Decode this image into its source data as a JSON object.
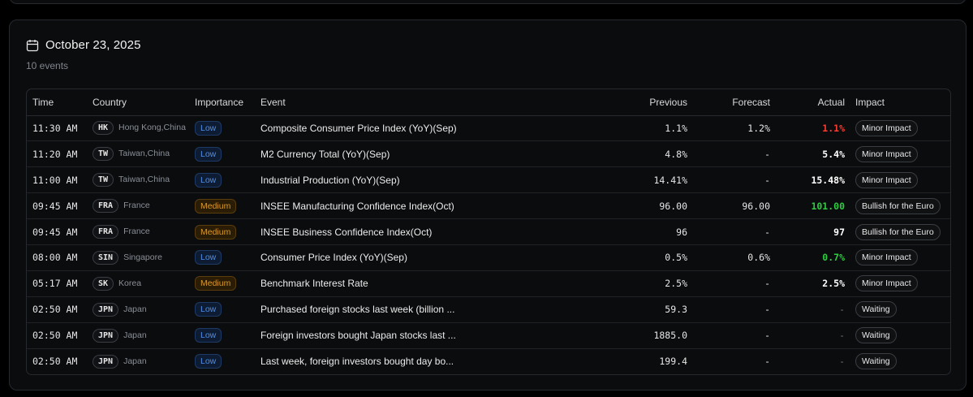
{
  "header": {
    "date": "October 23, 2025",
    "count": "10 events"
  },
  "columns": {
    "time": "Time",
    "country": "Country",
    "importance": "Importance",
    "event": "Event",
    "previous": "Previous",
    "forecast": "Forecast",
    "actual": "Actual",
    "impact": "Impact"
  },
  "colors": {
    "actual_up": "#2ecc40",
    "actual_down": "#ff3b30",
    "actual_neutral": "#ffffff",
    "actual_pending": "#6b7077"
  },
  "rows": [
    {
      "time": "11:30 AM",
      "code": "HK",
      "country": "Hong Kong,China",
      "importance": "Low",
      "event": "Composite Consumer Price Index (YoY)(Sep)",
      "previous": "1.1%",
      "forecast": "1.2%",
      "actual": "1.1%",
      "actual_state": "down",
      "impact": "Minor Impact"
    },
    {
      "time": "11:20 AM",
      "code": "TW",
      "country": "Taiwan,China",
      "importance": "Low",
      "event": "M2 Currency Total (YoY)(Sep)",
      "previous": "4.8%",
      "forecast": "-",
      "actual": "5.4%",
      "actual_state": "neutral",
      "impact": "Minor Impact"
    },
    {
      "time": "11:00 AM",
      "code": "TW",
      "country": "Taiwan,China",
      "importance": "Low",
      "event": "Industrial Production (YoY)(Sep)",
      "previous": "14.41%",
      "forecast": "-",
      "actual": "15.48%",
      "actual_state": "neutral",
      "impact": "Minor Impact"
    },
    {
      "time": "09:45 AM",
      "code": "FRA",
      "country": "France",
      "importance": "Medium",
      "event": "INSEE Manufacturing Confidence Index(Oct)",
      "previous": "96.00",
      "forecast": "96.00",
      "actual": "101.00",
      "actual_state": "up",
      "impact": "Bullish for the Euro"
    },
    {
      "time": "09:45 AM",
      "code": "FRA",
      "country": "France",
      "importance": "Medium",
      "event": "INSEE Business Confidence Index(Oct)",
      "previous": "96",
      "forecast": "-",
      "actual": "97",
      "actual_state": "neutral",
      "impact": "Bullish for the Euro"
    },
    {
      "time": "08:00 AM",
      "code": "SIN",
      "country": "Singapore",
      "importance": "Low",
      "event": "Consumer Price Index (YoY)(Sep)",
      "previous": "0.5%",
      "forecast": "0.6%",
      "actual": "0.7%",
      "actual_state": "up",
      "impact": "Minor Impact"
    },
    {
      "time": "05:17 AM",
      "code": "SK",
      "country": "Korea",
      "importance": "Medium",
      "event": "Benchmark Interest Rate",
      "previous": "2.5%",
      "forecast": "-",
      "actual": "2.5%",
      "actual_state": "neutral",
      "impact": "Minor Impact"
    },
    {
      "time": "02:50 AM",
      "code": "JPN",
      "country": "Japan",
      "importance": "Low",
      "event": "Purchased foreign stocks last week (billion ...",
      "previous": "59.3",
      "forecast": "-",
      "actual": "-",
      "actual_state": "pending",
      "impact": "Waiting"
    },
    {
      "time": "02:50 AM",
      "code": "JPN",
      "country": "Japan",
      "importance": "Low",
      "event": "Foreign investors bought Japan stocks last ...",
      "previous": "1885.0",
      "forecast": "-",
      "actual": "-",
      "actual_state": "pending",
      "impact": "Waiting"
    },
    {
      "time": "02:50 AM",
      "code": "JPN",
      "country": "Japan",
      "importance": "Low",
      "event": "Last week, foreign investors bought day bo...",
      "previous": "199.4",
      "forecast": "-",
      "actual": "-",
      "actual_state": "pending",
      "impact": "Waiting"
    }
  ]
}
